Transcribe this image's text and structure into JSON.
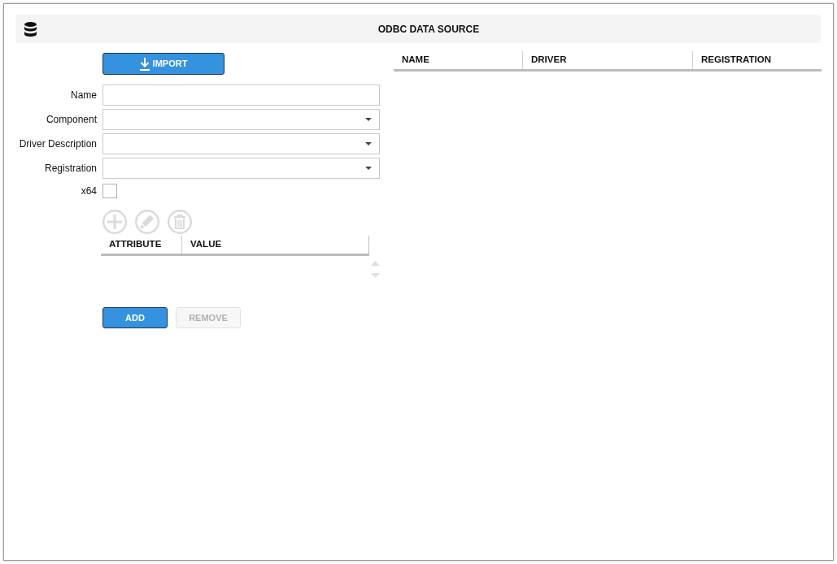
{
  "header": {
    "title": "ODBC DATA SOURCE"
  },
  "import_button": {
    "label": "IMPORT"
  },
  "form": {
    "fields": [
      {
        "label": "Name",
        "kind": "text"
      },
      {
        "label": "Component",
        "kind": "dropdown"
      },
      {
        "label": "Driver Description",
        "kind": "dropdown"
      },
      {
        "label": "Registration",
        "kind": "dropdown"
      }
    ],
    "x64": {
      "label": "x64",
      "checked": false
    }
  },
  "attribute_toolbar": [
    {
      "kind": "add",
      "disabled": true
    },
    {
      "kind": "edit",
      "disabled": true
    },
    {
      "kind": "delete",
      "disabled": true
    }
  ],
  "attributes_table": {
    "columns": [
      "ATTRIBUTE",
      "VALUE"
    ]
  },
  "buttons": [
    {
      "label": "ADD",
      "disabled": false
    },
    {
      "label": "REMOVE",
      "disabled": true
    }
  ],
  "data_sources_table": {
    "columns": [
      "NAME",
      "DRIVER",
      "REGISTRATION"
    ]
  }
}
